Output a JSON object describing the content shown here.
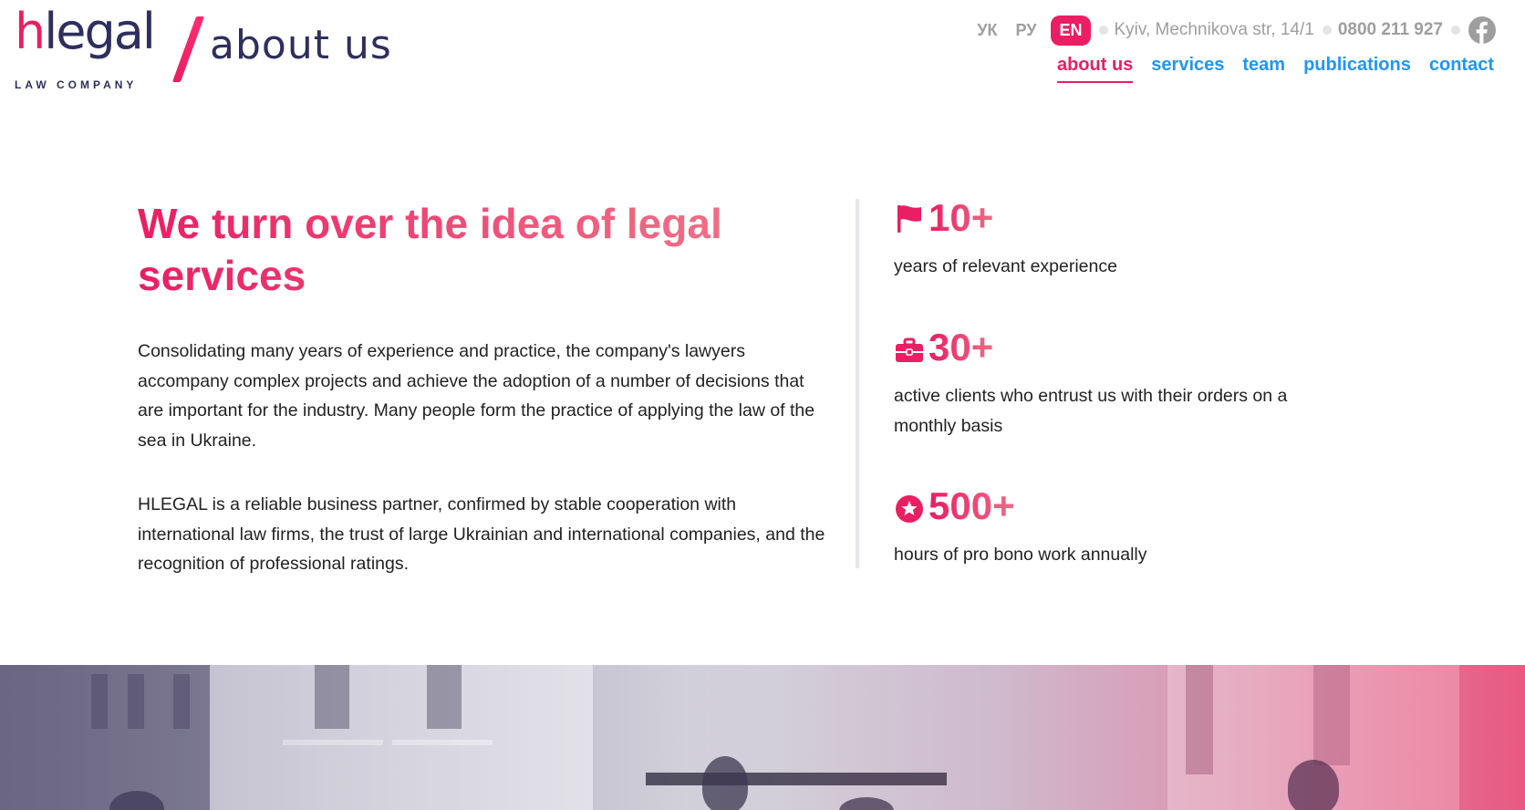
{
  "logo": {
    "brand_h": "h",
    "brand_rest": "legal",
    "section": "about us",
    "tagline": "LAW COMPANY"
  },
  "languages": [
    {
      "label": "УК",
      "active": false
    },
    {
      "label": "РУ",
      "active": false
    },
    {
      "label": "EN",
      "active": true
    }
  ],
  "contact": {
    "address": "Kyiv, Mechnikova str, 14/1",
    "phone": "0800 211 927",
    "social_icon": "facebook-icon"
  },
  "nav": [
    {
      "label": "about us",
      "active": true
    },
    {
      "label": "services",
      "active": false
    },
    {
      "label": "team",
      "active": false
    },
    {
      "label": "publications",
      "active": false
    },
    {
      "label": "contact",
      "active": false
    }
  ],
  "main": {
    "headline": "We turn over the idea of legal services",
    "paragraph1": "Consolidating many years of experience and practice, the company's lawyers accompany complex projects and achieve the adoption of a number of decisions that are important for the industry. Many people form the practice of applying the law of the sea in Ukraine.",
    "paragraph2": "HLEGAL is a reliable business partner, confirmed by stable cooperation with international law firms, the trust of large Ukrainian and international companies, and the recognition of professional ratings."
  },
  "stats": [
    {
      "icon": "flag-icon",
      "value": "10+",
      "label": "years of relevant experience"
    },
    {
      "icon": "briefcase-icon",
      "value": "30+",
      "label": "active clients who entrust us with their orders on a monthly basis"
    },
    {
      "icon": "star-badge-icon",
      "value": "500+",
      "label": "hours of pro bono work annually"
    }
  ],
  "colors": {
    "accent": "#e91e63",
    "nav_link": "#2196f3",
    "brand_dark": "#2e2f5e",
    "muted": "#9e9e9e"
  }
}
